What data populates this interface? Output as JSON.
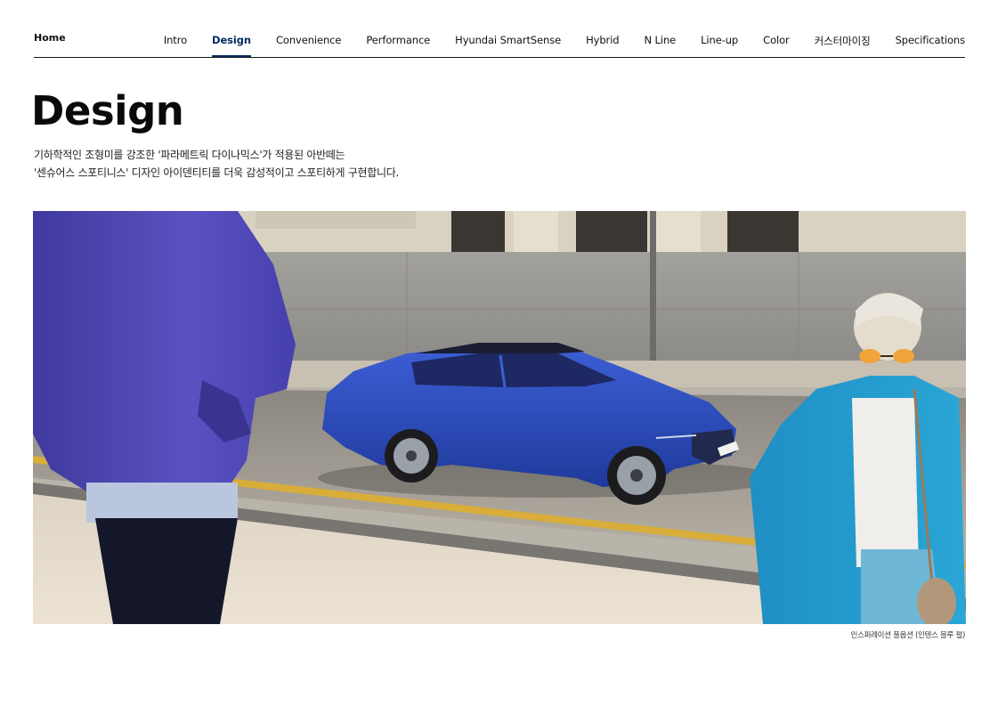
{
  "nav": {
    "home_label": "Home",
    "tabs": [
      {
        "label": "Intro",
        "active": false
      },
      {
        "label": "Design",
        "active": true
      },
      {
        "label": "Convenience",
        "active": false
      },
      {
        "label": "Performance",
        "active": false
      },
      {
        "label": "Hyundai SmartSense",
        "active": false
      },
      {
        "label": "Hybrid",
        "active": false
      },
      {
        "label": "N Line",
        "active": false
      },
      {
        "label": "Line-up",
        "active": false
      },
      {
        "label": "Color",
        "active": false
      },
      {
        "label": "커스터마이징",
        "active": false
      },
      {
        "label": "Specifications",
        "active": false
      }
    ]
  },
  "page": {
    "title": "Design",
    "desc_line1": "기하학적인 조형미를 강조한 '파라메트릭 다이나믹스'가 적용된 아반떼는",
    "desc_line2": "'센슈어스 스포티니스' 디자인 아이덴티티를 더욱 감성적이고 스포티하게 구현합니다."
  },
  "hero": {
    "caption": "인스퍼레이션 풀옵션 (인텐스 블루 펄)",
    "car_color": "#2f4fc4"
  },
  "colors": {
    "accent": "#002c5f"
  }
}
